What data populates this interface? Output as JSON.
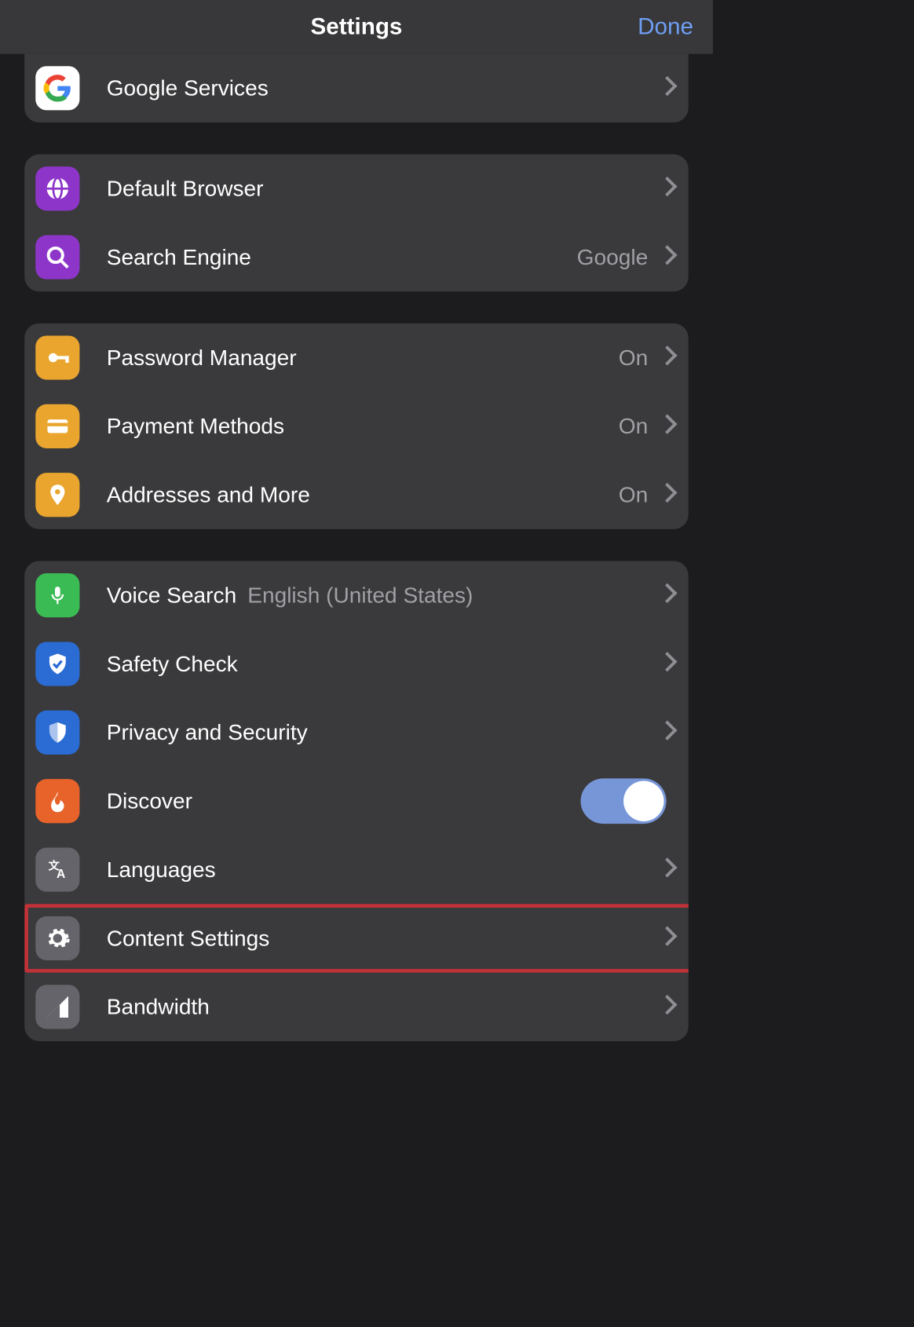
{
  "header": {
    "title": "Settings",
    "done": "Done"
  },
  "groups": {
    "g0": {
      "google_services": {
        "label": "Google Services"
      }
    },
    "g1": {
      "default_browser": {
        "label": "Default Browser"
      },
      "search_engine": {
        "label": "Search Engine",
        "value": "Google"
      }
    },
    "g2": {
      "password_manager": {
        "label": "Password Manager",
        "value": "On"
      },
      "payment_methods": {
        "label": "Payment Methods",
        "value": "On"
      },
      "addresses": {
        "label": "Addresses and More",
        "value": "On"
      }
    },
    "g3": {
      "voice_search": {
        "label": "Voice Search",
        "value": "English (United States)"
      },
      "safety_check": {
        "label": "Safety Check"
      },
      "privacy": {
        "label": "Privacy and Security"
      },
      "discover": {
        "label": "Discover",
        "toggle": true
      },
      "languages": {
        "label": "Languages"
      },
      "content_settings": {
        "label": "Content Settings"
      },
      "bandwidth": {
        "label": "Bandwidth"
      }
    }
  },
  "highlighted_row": "content_settings"
}
